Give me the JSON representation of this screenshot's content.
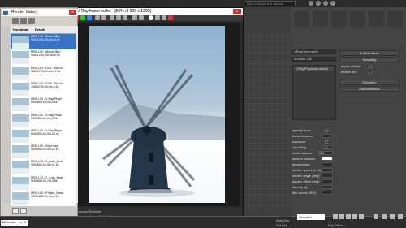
{
  "topbar": {
    "search_placeholder": "Type a keyword or phrase"
  },
  "command_panel": {
    "object_name": "VRayCamera001",
    "modifier_list": "Modifier List",
    "stack_item": "VRayPhysicalCamera",
    "rollouts": {
      "bokeh": "Bokeh effects",
      "sampling": "Sampling",
      "distortion": "Distortion",
      "misc": "Miscellaneous"
    },
    "sampling": {
      "dof_label": "depth-of-field",
      "motion_blur_label": "motion blur"
    },
    "params": [
      {
        "label": "specify focus"
      },
      {
        "label": "focus distance",
        "value": ""
      },
      {
        "label": "exposure"
      },
      {
        "label": "vignetting",
        "value": "1.0"
      },
      {
        "label": "white balance",
        "value": "D65"
      },
      {
        "label": "custom balance"
      },
      {
        "label": "temperature",
        "value": ""
      },
      {
        "label": "shutter speed (s^-1)",
        "value": ""
      },
      {
        "label": "shutter angle (deg)",
        "value": ""
      },
      {
        "label": "shutter offset (deg)",
        "value": ""
      },
      {
        "label": "latency (s)",
        "value": ""
      },
      {
        "label": "film speed (ISO)",
        "value": ""
      }
    ]
  },
  "render_history": {
    "title": "Render history",
    "columns": [
      "Thumbnail",
      "Details"
    ],
    "items": [
      {
        "line1": "M05_L05 - Motion Blur",
        "line2": "900x1200, 0h,0m,5.3s",
        "selected": true
      },
      {
        "line1": "M05_L05 - Motion Blur",
        "line2": "900x1200, 0h,0m,5.3s",
        "selected": false
      },
      {
        "line1": "M05_L04 - DOF - End.m",
        "line2": "1280x720,0h,0m,17.5s",
        "selected": false
      },
      {
        "line1": "M05_L04 - DOF - End.m",
        "line2": "1280x720,0h,0m,5.5s",
        "selected": false
      },
      {
        "line1": "M05_L03 - V-Ray Physi",
        "line2": "900x506,0h,0m,2.0s",
        "selected": false
      },
      {
        "line1": "M05_L02 - V-Ray Physi",
        "line2": "900x506,0h,0m,2.7s",
        "selected": false
      },
      {
        "line1": "M05_L02 - V-Ray Physi",
        "line2": "900x506,0h,0m,23.4s",
        "selected": false
      },
      {
        "line1": "M05_L09 - Start.max",
        "line2": "900x506,0h,0m,22.9s",
        "selected": false
      },
      {
        "line1": "M03_L13 - 2_Auto_Bear",
        "line2": "900x506,0h,4m,41.5s",
        "selected": false
      },
      {
        "line1": "M03_L13 - 2_Auto_Bear",
        "line2": "900x506,0h,7m,0.5s",
        "selected": false
      },
      {
        "line1": "M03_L09 - Project_Rese",
        "line2": "1000x800,0h,3m,6.0s",
        "selected": false
      }
    ]
  },
  "frame_buffer": {
    "title": "V-Ray frame buffer - [50% of 900 x 1200]",
    "status_text": "1 Camera Selected",
    "status_text2": "Rendering Time: 0h 0m 5.3s"
  },
  "status": {
    "welcome": "Welcome to M",
    "selected": "Selected",
    "auto_key": "Auto Key",
    "set_key": "Set Key",
    "key_filters": "Key Filters..."
  },
  "colors": {
    "accent": "#3b73c4",
    "close": "#c0392b",
    "panel": "#444444"
  }
}
